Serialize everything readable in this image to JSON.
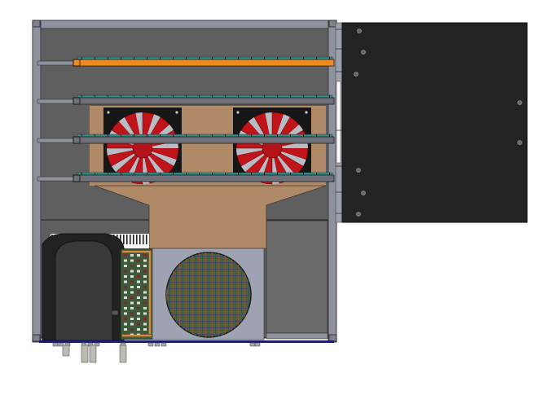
{
  "scene": {
    "colors": {
      "background": "#ffffff",
      "frame": "#8d929c",
      "frame_dark": "#3c3f46",
      "back_panel": "#5f5f5f",
      "right_panel": "#696969",
      "tan_panel": "#b08a66",
      "shelf": "#6d7078",
      "shelf_edge": "#2f8f8a",
      "orange_strip": "#f08a1c",
      "fan_housing": "#161616",
      "fan_red": "#c0141a",
      "fan_white": "#b9bcc4",
      "radiator_box": "#9ea2b2",
      "radiator_core": "#5a5a3c",
      "compressor": "#2b2b2b",
      "pcb": "#3f5a3a",
      "pcb_trace": "#d98a3a",
      "base_line": "#1b1f6b",
      "door": "#232323",
      "hinge": "#9ba0aa"
    },
    "fan_count": 2,
    "shelf_count": 4
  }
}
